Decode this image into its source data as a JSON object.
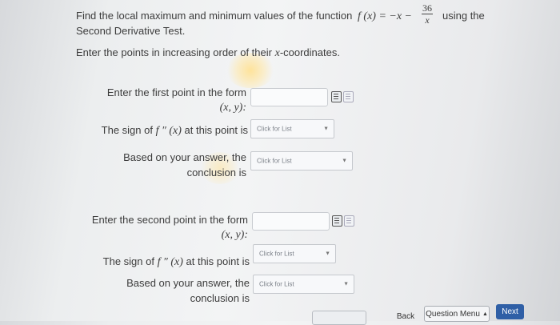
{
  "question": {
    "line1_before": "Find the local maximum and minimum values of the function",
    "func_left": "f (x) = −x −",
    "frac_num": "36",
    "frac_den": "x",
    "line1_after": "using the",
    "line2": "Second Derivative Test.",
    "instruction_before": "Enter the points in increasing order of their",
    "instruction_var": "x",
    "instruction_after": "-coordinates."
  },
  "first_point": {
    "label_line1": "Enter the first point in the form",
    "label_line2": "(x, y):",
    "input_value": "",
    "sign_label_before": "The sign of",
    "sign_label_math": "f ″ (x)",
    "sign_label_after": "at this point is",
    "sign_select": "Click for List",
    "conclusion_line1": "Based on your answer, the",
    "conclusion_line2": "conclusion is",
    "conclusion_select": "Click for List"
  },
  "second_point": {
    "label_line1": "Enter the second point in the form",
    "label_line2": "(x, y):",
    "input_value": "",
    "sign_label_before": "The sign of",
    "sign_label_math": "f ″ (x)",
    "sign_label_after": "at this point is",
    "sign_select": "Click for List",
    "conclusion_line1": "Based on your answer, the",
    "conclusion_line2": "conclusion is",
    "conclusion_select": "Click for List"
  },
  "footer": {
    "back": "Back",
    "question_menu": "Question Menu",
    "next": "Next"
  },
  "colors": {
    "next_button": "#2f5fa6"
  }
}
